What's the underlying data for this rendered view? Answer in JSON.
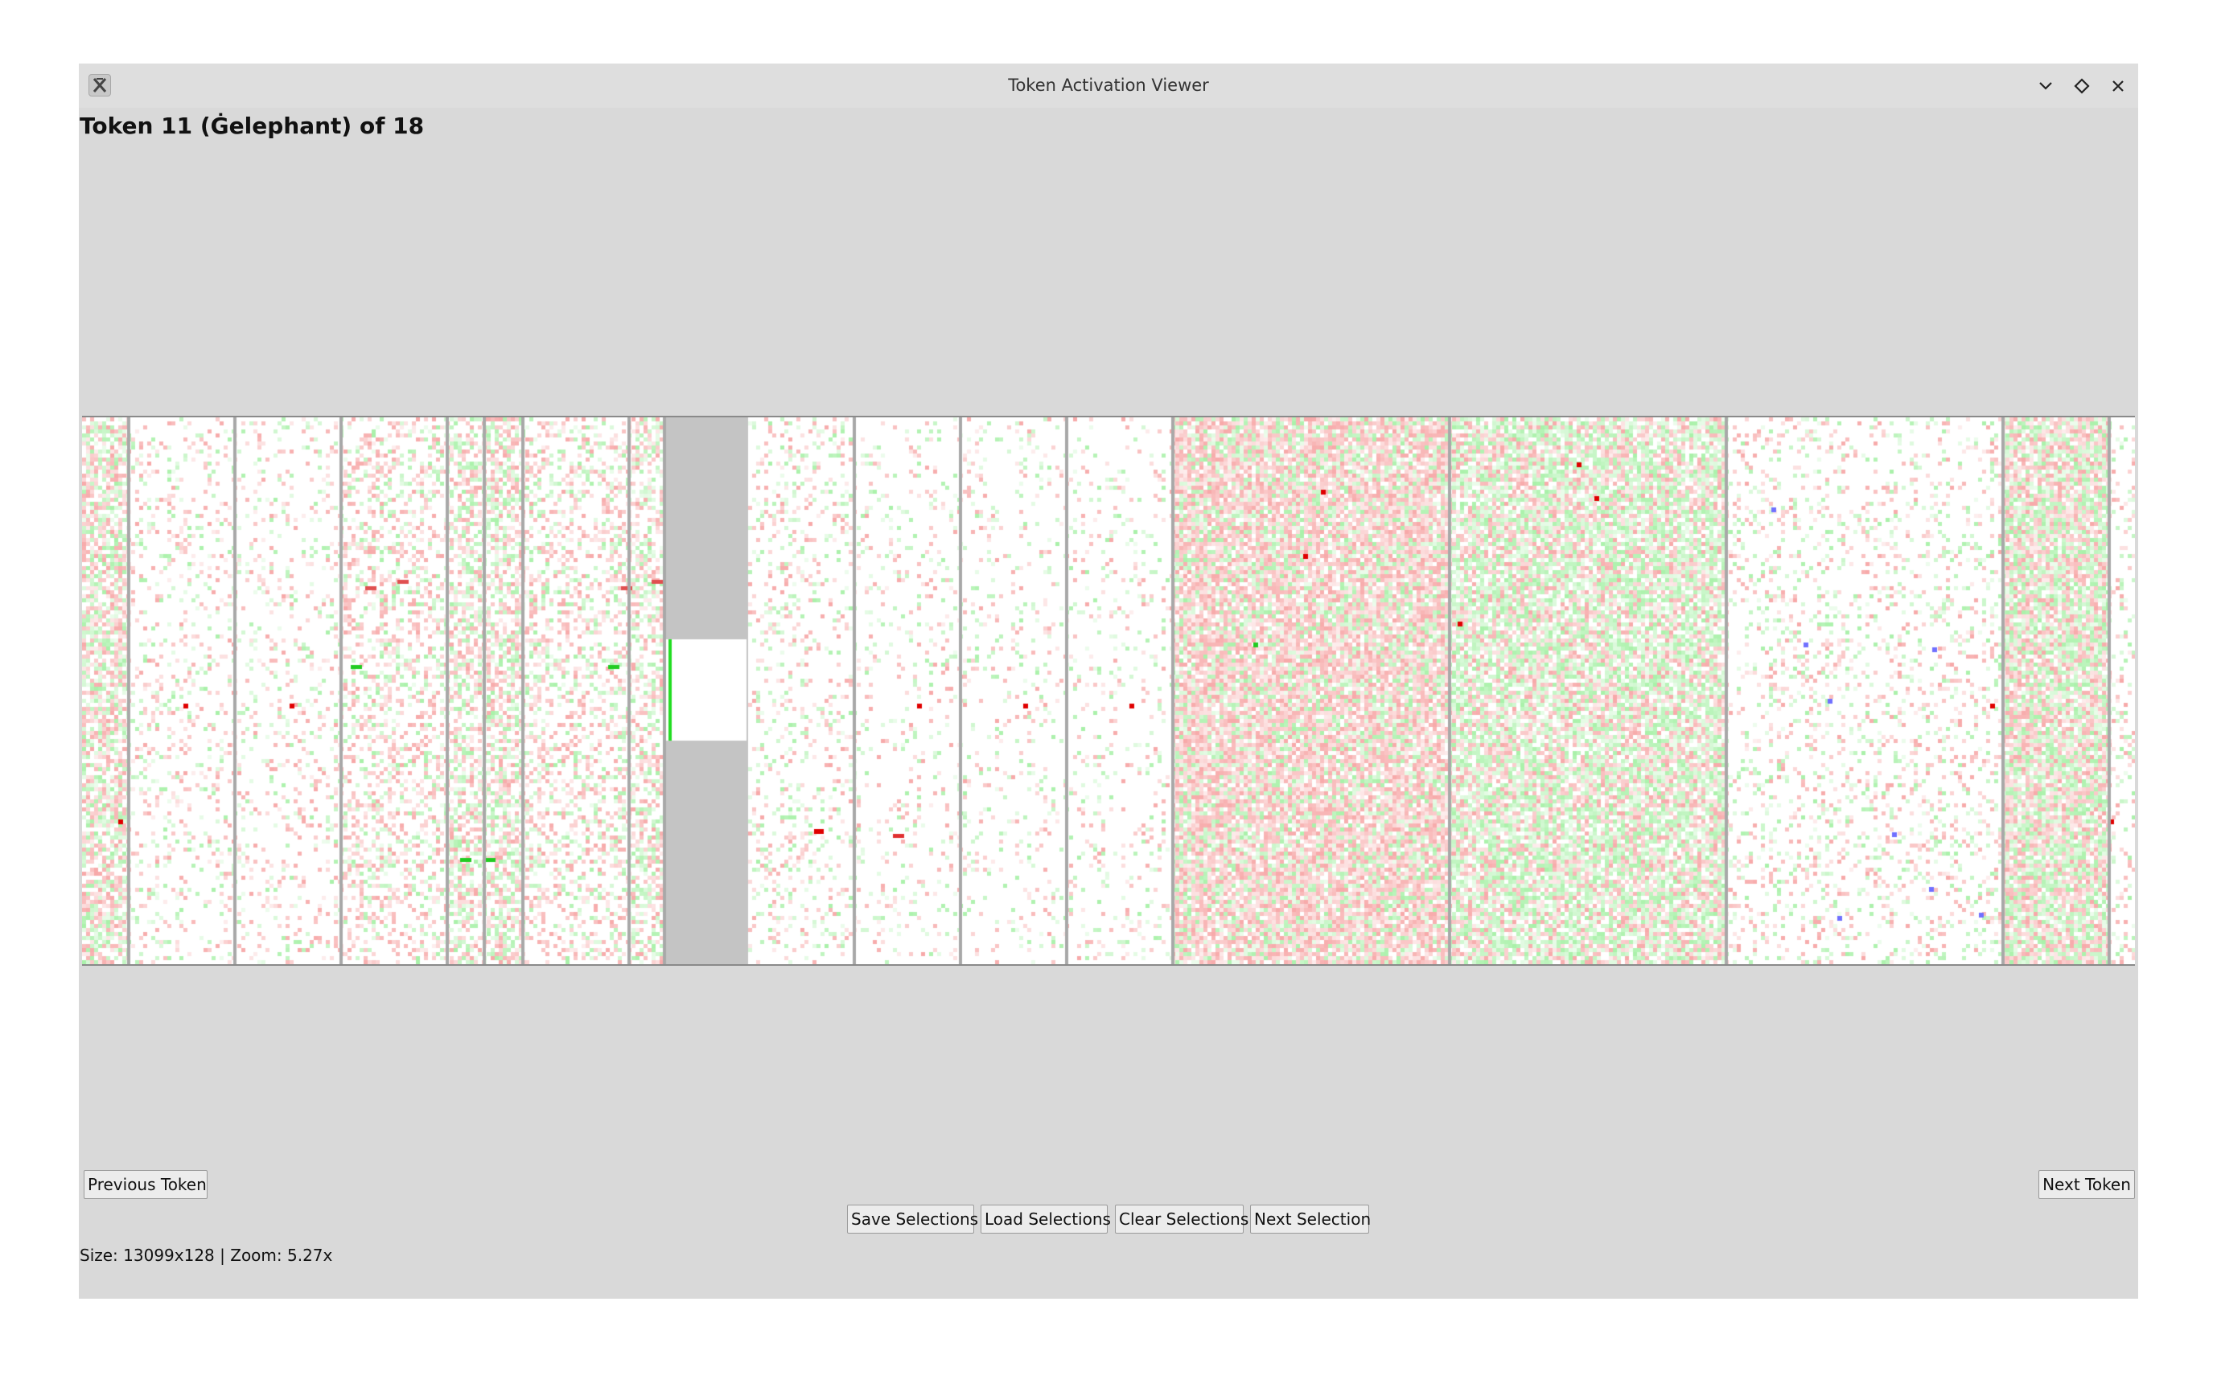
{
  "window": {
    "title": "Token Activation Viewer",
    "controls": [
      "minimize-icon",
      "maximize-icon",
      "close-icon"
    ]
  },
  "header": {
    "token_title": "Token 11 (Ġelephant) of 18"
  },
  "heatmap": {
    "description_colors": {
      "positive": "#00dd00",
      "negative": "#ee0000",
      "other": "#6a6aff",
      "masked": "#c4c4c4"
    }
  },
  "navigation": {
    "previous_label": "Previous Token",
    "next_label": "Next Token"
  },
  "actions": {
    "save_label": "Save Selections",
    "load_label": "Load Selections",
    "clear_label": "Clear Selections",
    "next_selection_label": "Next Selection"
  },
  "status": {
    "text": "Size: 13099x128 | Zoom: 5.27x"
  }
}
